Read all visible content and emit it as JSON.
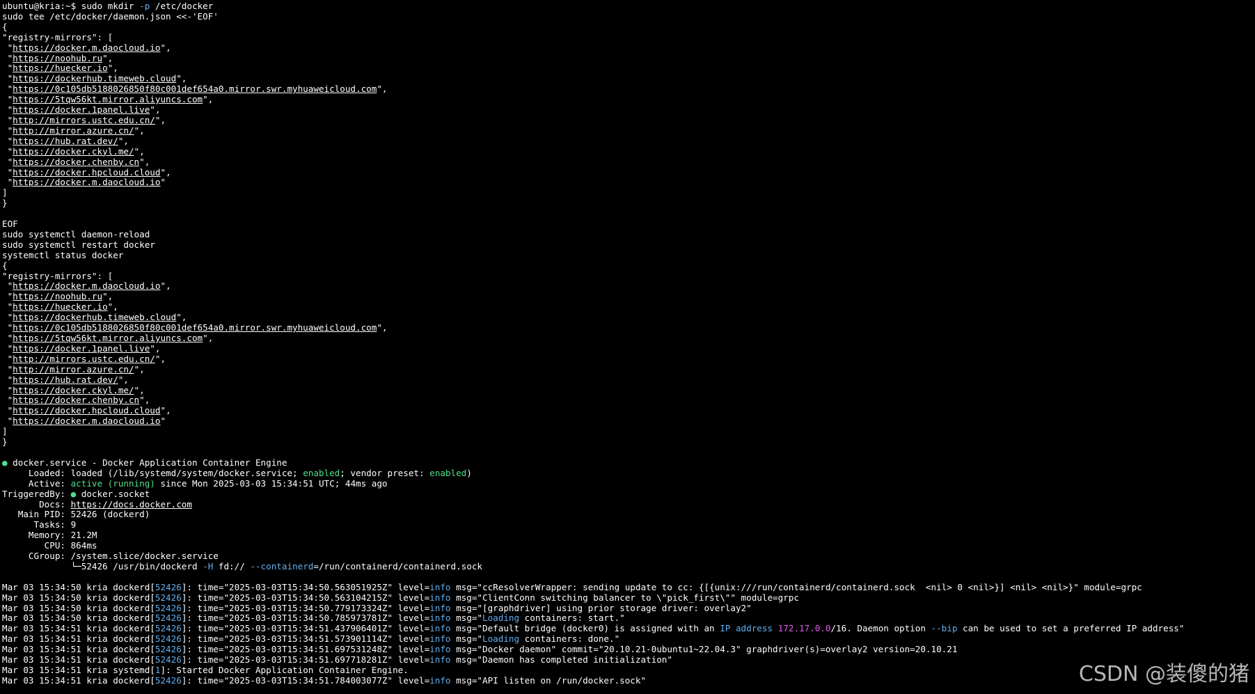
{
  "terminal": {
    "lines": [
      [
        {
          "t": "ubuntu@kria:~$ sudo mkdir "
        },
        {
          "t": "-p",
          "c": "blue"
        },
        {
          "t": " /etc/docker"
        }
      ],
      [
        {
          "t": "sudo tee /etc/docker/daemon.json <<-'EOF'"
        }
      ],
      [
        {
          "t": "{"
        }
      ],
      [
        {
          "t": "\"registry-mirrors\": ["
        }
      ],
      [
        {
          "t": " \""
        },
        {
          "t": "https://docker.m.daocloud.io",
          "u": true
        },
        {
          "t": "\","
        }
      ],
      [
        {
          "t": " \""
        },
        {
          "t": "https://noohub.ru",
          "u": true
        },
        {
          "t": "\","
        }
      ],
      [
        {
          "t": " \""
        },
        {
          "t": "https://huecker.io",
          "u": true
        },
        {
          "t": "\","
        }
      ],
      [
        {
          "t": " \""
        },
        {
          "t": "https://dockerhub.timeweb.cloud",
          "u": true
        },
        {
          "t": "\","
        }
      ],
      [
        {
          "t": " \""
        },
        {
          "t": "https://0c105db5188026850f80c001def654a0.mirror.swr.myhuaweicloud.com",
          "u": true
        },
        {
          "t": "\","
        }
      ],
      [
        {
          "t": " \""
        },
        {
          "t": "https://5tqw56kt.mirror.aliyuncs.com",
          "u": true
        },
        {
          "t": "\","
        }
      ],
      [
        {
          "t": " \""
        },
        {
          "t": "https://docker.1panel.live",
          "u": true
        },
        {
          "t": "\","
        }
      ],
      [
        {
          "t": " \""
        },
        {
          "t": "http://mirrors.ustc.edu.cn/",
          "u": true
        },
        {
          "t": "\","
        }
      ],
      [
        {
          "t": " \""
        },
        {
          "t": "http://mirror.azure.cn/",
          "u": true
        },
        {
          "t": "\","
        }
      ],
      [
        {
          "t": " \""
        },
        {
          "t": "https://hub.rat.dev/",
          "u": true
        },
        {
          "t": "\","
        }
      ],
      [
        {
          "t": " \""
        },
        {
          "t": "https://docker.ckyl.me/",
          "u": true
        },
        {
          "t": "\","
        }
      ],
      [
        {
          "t": " \""
        },
        {
          "t": "https://docker.chenby.cn",
          "u": true
        },
        {
          "t": "\","
        }
      ],
      [
        {
          "t": " \""
        },
        {
          "t": "https://docker.hpcloud.cloud",
          "u": true
        },
        {
          "t": "\","
        }
      ],
      [
        {
          "t": " \""
        },
        {
          "t": "https://docker.m.daocloud.io",
          "u": true
        },
        {
          "t": "\""
        }
      ],
      [
        {
          "t": "]"
        }
      ],
      [
        {
          "t": "}"
        }
      ],
      [
        {
          "t": ""
        }
      ],
      [
        {
          "t": "EOF"
        }
      ],
      [
        {
          "t": "sudo systemctl daemon-reload"
        }
      ],
      [
        {
          "t": "sudo systemctl restart docker"
        }
      ],
      [
        {
          "t": "systemctl status docker"
        }
      ],
      [
        {
          "t": "{"
        }
      ],
      [
        {
          "t": "\"registry-mirrors\": ["
        }
      ],
      [
        {
          "t": " \""
        },
        {
          "t": "https://docker.m.daocloud.io",
          "u": true
        },
        {
          "t": "\","
        }
      ],
      [
        {
          "t": " \""
        },
        {
          "t": "https://noohub.ru",
          "u": true
        },
        {
          "t": "\","
        }
      ],
      [
        {
          "t": " \""
        },
        {
          "t": "https://huecker.io",
          "u": true
        },
        {
          "t": "\","
        }
      ],
      [
        {
          "t": " \""
        },
        {
          "t": "https://dockerhub.timeweb.cloud",
          "u": true
        },
        {
          "t": "\","
        }
      ],
      [
        {
          "t": " \""
        },
        {
          "t": "https://0c105db5188026850f80c001def654a0.mirror.swr.myhuaweicloud.com",
          "u": true
        },
        {
          "t": "\","
        }
      ],
      [
        {
          "t": " \""
        },
        {
          "t": "https://5tqw56kt.mirror.aliyuncs.com",
          "u": true
        },
        {
          "t": "\","
        }
      ],
      [
        {
          "t": " \""
        },
        {
          "t": "https://docker.1panel.live",
          "u": true
        },
        {
          "t": "\","
        }
      ],
      [
        {
          "t": " \""
        },
        {
          "t": "http://mirrors.ustc.edu.cn/",
          "u": true
        },
        {
          "t": "\","
        }
      ],
      [
        {
          "t": " \""
        },
        {
          "t": "http://mirror.azure.cn/",
          "u": true
        },
        {
          "t": "\","
        }
      ],
      [
        {
          "t": " \""
        },
        {
          "t": "https://hub.rat.dev/",
          "u": true
        },
        {
          "t": "\","
        }
      ],
      [
        {
          "t": " \""
        },
        {
          "t": "https://docker.ckyl.me/",
          "u": true
        },
        {
          "t": "\","
        }
      ],
      [
        {
          "t": " \""
        },
        {
          "t": "https://docker.chenby.cn",
          "u": true
        },
        {
          "t": "\","
        }
      ],
      [
        {
          "t": " \""
        },
        {
          "t": "https://docker.hpcloud.cloud",
          "u": true
        },
        {
          "t": "\","
        }
      ],
      [
        {
          "t": " \""
        },
        {
          "t": "https://docker.m.daocloud.io",
          "u": true
        },
        {
          "t": "\""
        }
      ],
      [
        {
          "t": "]"
        }
      ],
      [
        {
          "t": "}"
        }
      ],
      [
        {
          "t": ""
        }
      ],
      [
        {
          "t": "●",
          "c": "dot"
        },
        {
          "t": " docker.service - Docker Application Container Engine"
        }
      ],
      [
        {
          "t": "     Loaded: loaded (/lib/systemd/system/docker.service; "
        },
        {
          "t": "enabled",
          "c": "green"
        },
        {
          "t": "; vendor preset: "
        },
        {
          "t": "enabled",
          "c": "green"
        },
        {
          "t": ")"
        }
      ],
      [
        {
          "t": "     Active: "
        },
        {
          "t": "active (running)",
          "c": "green"
        },
        {
          "t": " since Mon 2025-03-03 15:34:51 UTC; 44ms ago"
        }
      ],
      [
        {
          "t": "TriggeredBy: "
        },
        {
          "t": "●",
          "c": "dot"
        },
        {
          "t": " docker.socket"
        }
      ],
      [
        {
          "t": "       Docs: "
        },
        {
          "t": "https://docs.docker.com",
          "u": true
        }
      ],
      [
        {
          "t": "   Main PID: 52426 (dockerd)"
        }
      ],
      [
        {
          "t": "      Tasks: 9"
        }
      ],
      [
        {
          "t": "     Memory: 21.2M"
        }
      ],
      [
        {
          "t": "        CPU: 864ms"
        }
      ],
      [
        {
          "t": "     CGroup: /system.slice/docker.service"
        }
      ],
      [
        {
          "t": "             └─52426 /usr/bin/dockerd "
        },
        {
          "t": "-H",
          "c": "blue"
        },
        {
          "t": " fd:// "
        },
        {
          "t": "--containerd",
          "c": "blue"
        },
        {
          "t": "=/run/containerd/containerd.sock"
        }
      ],
      [
        {
          "t": ""
        }
      ],
      [
        {
          "t": "Mar 03 15:34:50 kria dockerd["
        },
        {
          "t": "52426",
          "c": "blue"
        },
        {
          "t": "]: time=\"2025-03-03T15:34:50.563051925Z\" level="
        },
        {
          "t": "info",
          "c": "blue"
        },
        {
          "t": " msg=\"ccResolverWrapper: sending update to cc: {[{unix:///run/containerd/containerd.sock  <nil> 0 <nil>}] <nil> <nil>}\" module=grpc"
        }
      ],
      [
        {
          "t": "Mar 03 15:34:50 kria dockerd["
        },
        {
          "t": "52426",
          "c": "blue"
        },
        {
          "t": "]: time=\"2025-03-03T15:34:50.563104215Z\" level="
        },
        {
          "t": "info",
          "c": "blue"
        },
        {
          "t": " msg=\"ClientConn switching balancer to \\\"pick_first\\\"\" module=grpc"
        }
      ],
      [
        {
          "t": "Mar 03 15:34:50 kria dockerd["
        },
        {
          "t": "52426",
          "c": "blue"
        },
        {
          "t": "]: time=\"2025-03-03T15:34:50.779173324Z\" level="
        },
        {
          "t": "info",
          "c": "blue"
        },
        {
          "t": " msg=\"[graphdriver] using prior storage driver: overlay2\""
        }
      ],
      [
        {
          "t": "Mar 03 15:34:50 kria dockerd["
        },
        {
          "t": "52426",
          "c": "blue"
        },
        {
          "t": "]: time=\"2025-03-03T15:34:50.785973781Z\" level="
        },
        {
          "t": "info",
          "c": "blue"
        },
        {
          "t": " msg=\""
        },
        {
          "t": "Loading",
          "c": "blue"
        },
        {
          "t": " containers: start.\""
        }
      ],
      [
        {
          "t": "Mar 03 15:34:51 kria dockerd["
        },
        {
          "t": "52426",
          "c": "blue"
        },
        {
          "t": "]: time=\"2025-03-03T15:34:51.437906401Z\" level="
        },
        {
          "t": "info",
          "c": "blue"
        },
        {
          "t": " msg=\"Default bridge (docker0) is assigned with an "
        },
        {
          "t": "IP address",
          "c": "blue"
        },
        {
          "t": " "
        },
        {
          "t": "172.17.0.0",
          "c": "purple"
        },
        {
          "t": "/16. Daemon option "
        },
        {
          "t": "--bip",
          "c": "blue"
        },
        {
          "t": " can be used to set a preferred IP address\""
        }
      ],
      [
        {
          "t": "Mar 03 15:34:51 kria dockerd["
        },
        {
          "t": "52426",
          "c": "blue"
        },
        {
          "t": "]: time=\"2025-03-03T15:34:51.573901114Z\" level="
        },
        {
          "t": "info",
          "c": "blue"
        },
        {
          "t": " msg=\""
        },
        {
          "t": "Loading",
          "c": "blue"
        },
        {
          "t": " containers: done.\""
        }
      ],
      [
        {
          "t": "Mar 03 15:34:51 kria dockerd["
        },
        {
          "t": "52426",
          "c": "blue"
        },
        {
          "t": "]: time=\"2025-03-03T15:34:51.697531248Z\" level="
        },
        {
          "t": "info",
          "c": "blue"
        },
        {
          "t": " msg=\"Docker daemon\" commit=\"20.10.21-0ubuntu1~22.04.3\" graphdriver(s)=overlay2 version=20.10.21"
        }
      ],
      [
        {
          "t": "Mar 03 15:34:51 kria dockerd["
        },
        {
          "t": "52426",
          "c": "blue"
        },
        {
          "t": "]: time=\"2025-03-03T15:34:51.697718281Z\" level="
        },
        {
          "t": "info",
          "c": "blue"
        },
        {
          "t": " msg=\"Daemon has completed initialization\""
        }
      ],
      [
        {
          "t": "Mar 03 15:34:51 kria systemd["
        },
        {
          "t": "1",
          "c": "blue"
        },
        {
          "t": "]: Started Docker Application Container Engine."
        }
      ],
      [
        {
          "t": "Mar 03 15:34:51 kria dockerd["
        },
        {
          "t": "52426",
          "c": "blue"
        },
        {
          "t": "]: time=\"2025-03-03T15:34:51.784003077Z\" level="
        },
        {
          "t": "info",
          "c": "blue"
        },
        {
          "t": " msg=\"API listen on /run/docker.sock\""
        }
      ]
    ]
  },
  "watermark": "CSDN @装傻的猪",
  "colors": {
    "background": "#000000",
    "text": "#ffffff",
    "blue": "#61afef",
    "green": "#4fe08a",
    "purple": "#e05cf0"
  }
}
